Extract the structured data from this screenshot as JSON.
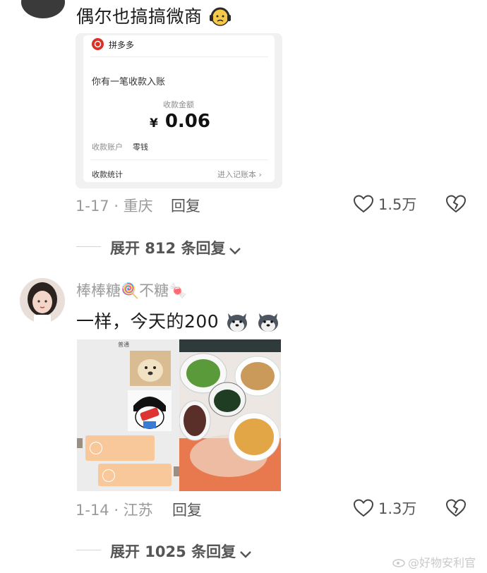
{
  "comment1": {
    "text": "偶尔也搞搞微商",
    "emoji": "headphones-sad-face",
    "receipt": {
      "app_name": "拼多多",
      "notice": "你有一笔收款入账",
      "amount_label": "收款金额",
      "currency": "¥",
      "amount": "0.06",
      "account_label": "收款账户",
      "account_value": "零钱",
      "stats_label": "收款统计",
      "ledger_link": "进入记账本 ›"
    },
    "meta": "1-17 · 重庆",
    "reply": "回复",
    "likes": "1.5万",
    "expand": "展开 812 条回复"
  },
  "comment2": {
    "username": "棒棒糖🍭不糖🍬",
    "text": "一样，今天的200",
    "emoji": "husky-dog-face",
    "chat_title": "普通",
    "meta": "1-14 · 江苏",
    "reply": "回复",
    "likes": "1.3万",
    "expand": "展开 1025 条回复"
  },
  "watermark": "@好物安利官",
  "colors": {
    "background": "#ffffff",
    "muted": "#9b9b9b",
    "pdd_red": "#e02e24"
  }
}
